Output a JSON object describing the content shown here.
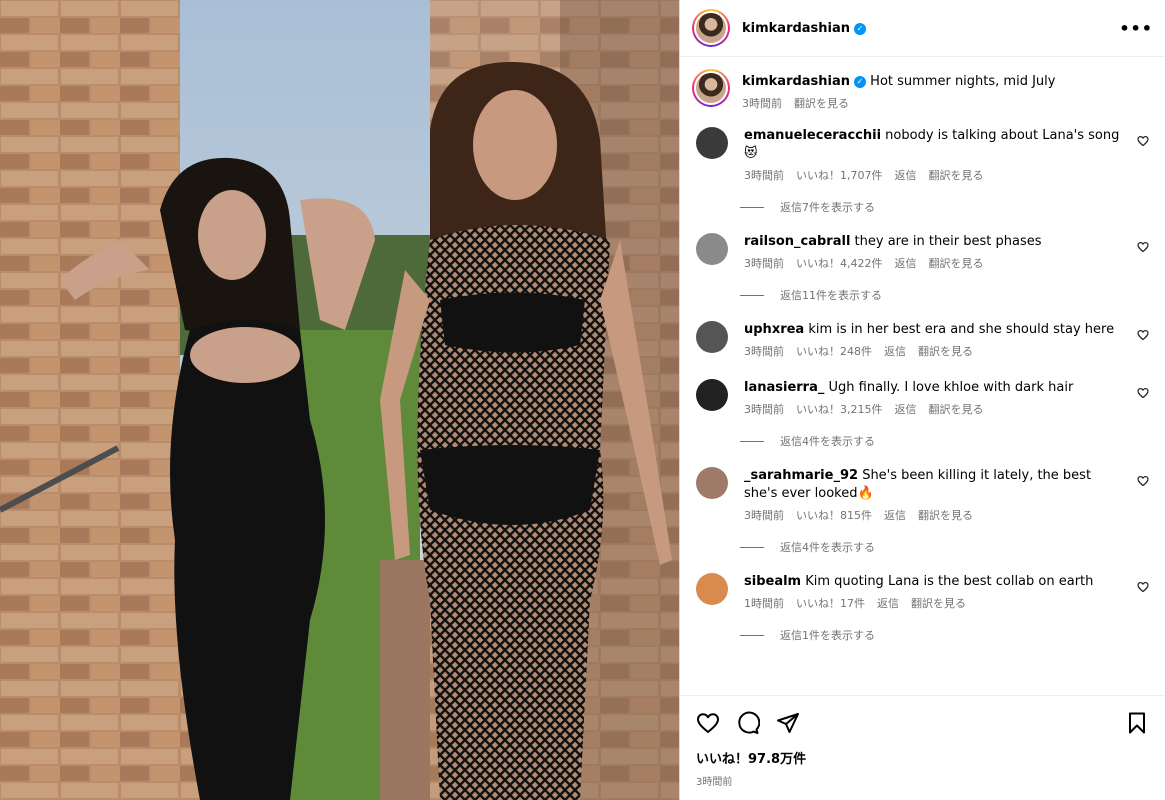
{
  "post": {
    "author": "kimkardashian",
    "more_label": "•••"
  },
  "caption": {
    "username": "kimkardashian",
    "text": "Hot summer nights, mid July",
    "time": "3時間前",
    "translate": "翻訳を見る"
  },
  "comments": [
    {
      "username": "emanueleceracchii",
      "text": "nobody is talking about Lana's song",
      "emoji": "😻",
      "time": "3時間前",
      "likes": "いいね！1,707件",
      "reply": "返信",
      "translate": "翻訳を見る",
      "replies": "返信7件を表示する",
      "avatar_color": "#3a3a3a"
    },
    {
      "username": "railson_cabrall",
      "text": "they are in their best phases",
      "emoji": "",
      "time": "3時間前",
      "likes": "いいね！4,422件",
      "reply": "返信",
      "translate": "翻訳を見る",
      "replies": "返信11件を表示する",
      "avatar_color": "#8a8a8a"
    },
    {
      "username": "uphxrea",
      "text": "kim is in her best era and she should stay here",
      "emoji": "",
      "time": "3時間前",
      "likes": "いいね！248件",
      "reply": "返信",
      "translate": "翻訳を見る",
      "replies": "",
      "avatar_color": "#555555"
    },
    {
      "username": "lanasierra_",
      "text": "Ugh finally. I love khloe with dark hair",
      "emoji": "",
      "time": "3時間前",
      "likes": "いいね！3,215件",
      "reply": "返信",
      "translate": "翻訳を見る",
      "replies": "返信4件を表示する",
      "avatar_color": "#222222"
    },
    {
      "username": "_sarahmarie_92",
      "text": "She's been killing it lately, the best she's ever looked",
      "emoji": "🔥",
      "time": "3時間前",
      "likes": "いいね！815件",
      "reply": "返信",
      "translate": "翻訳を見る",
      "replies": "返信4件を表示する",
      "avatar_color": "#a07a68"
    },
    {
      "username": "sibealm",
      "text": "Kim quoting Lana is the best collab on earth",
      "emoji": "",
      "time": "1時間前",
      "likes": "いいね！17件",
      "reply": "返信",
      "translate": "翻訳を見る",
      "replies": "返信1件を表示する",
      "avatar_color": "#d98a4e"
    }
  ],
  "footer": {
    "likes": "いいね！97.8万件",
    "time": "3時間前"
  }
}
